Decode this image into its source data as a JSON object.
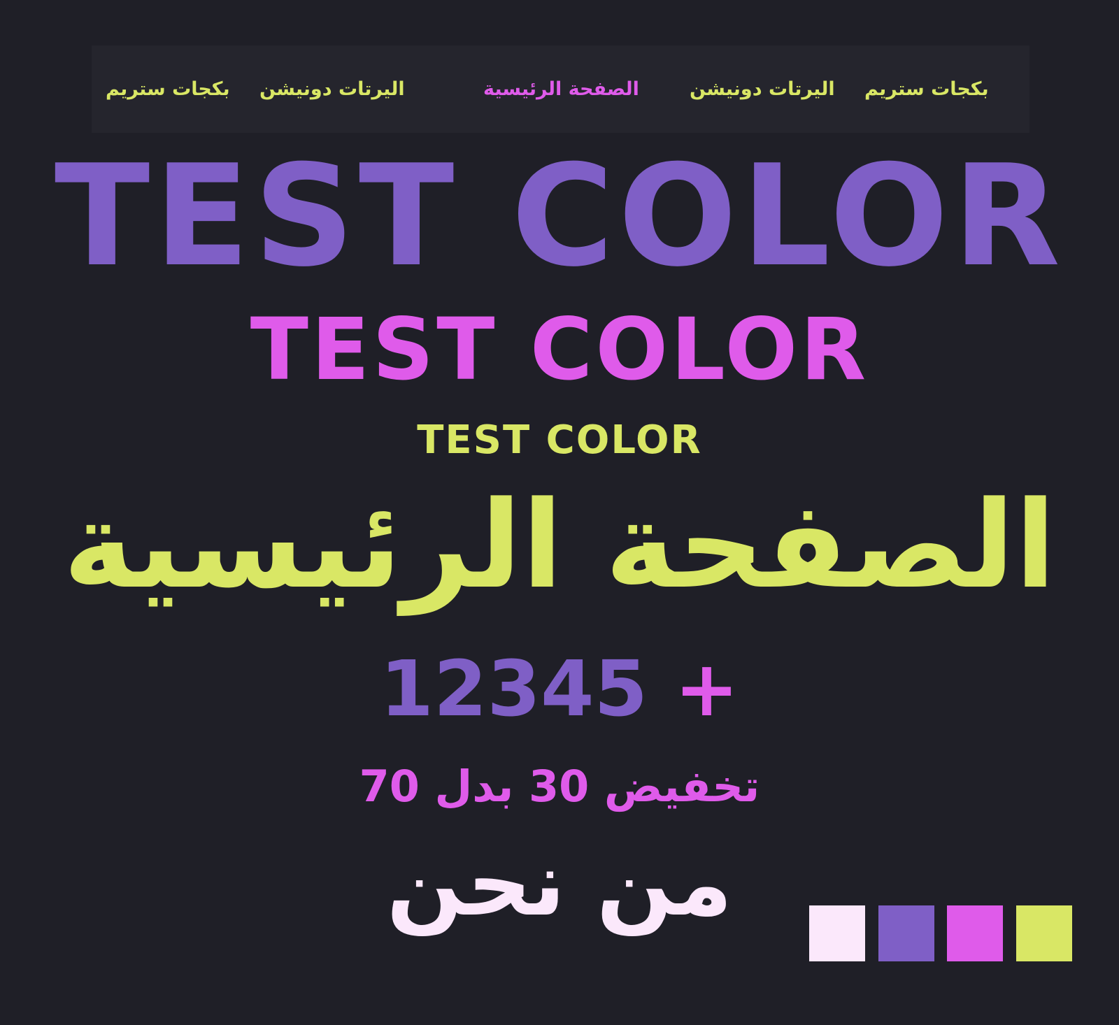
{
  "nav": {
    "items": [
      {
        "label": "بكجات ستريم",
        "color": "#d9e765"
      },
      {
        "label": "اليرتات دونيشن",
        "color": "#d9e765"
      },
      {
        "label": "الصفحة الرئيسية",
        "color": "#df5bea"
      },
      {
        "label": "اليرتات دونيشن",
        "color": "#d9e765"
      },
      {
        "label": "بكجات ستريم",
        "color": "#d9e765"
      }
    ]
  },
  "main": {
    "heading_large": "TEST COLOR",
    "heading_medium": "TEST COLOR",
    "heading_small": "TEST COLOR",
    "arabic_title": "الصفحة الرئيسية",
    "number_value": "12345",
    "number_prefix": "+",
    "discount_text": "تخفيض 30 بدل 70",
    "about_text": "من نحن"
  },
  "palette": {
    "colors": [
      "#fbe8fb",
      "#7f5fc6",
      "#df5bea",
      "#d9e765"
    ]
  },
  "theme": {
    "background": "#1f1f27",
    "navbar_background": "#25252d",
    "purple": "#7f5fc6",
    "pink": "#df5bea",
    "lime": "#d9e765",
    "light": "#fbe8fb"
  }
}
